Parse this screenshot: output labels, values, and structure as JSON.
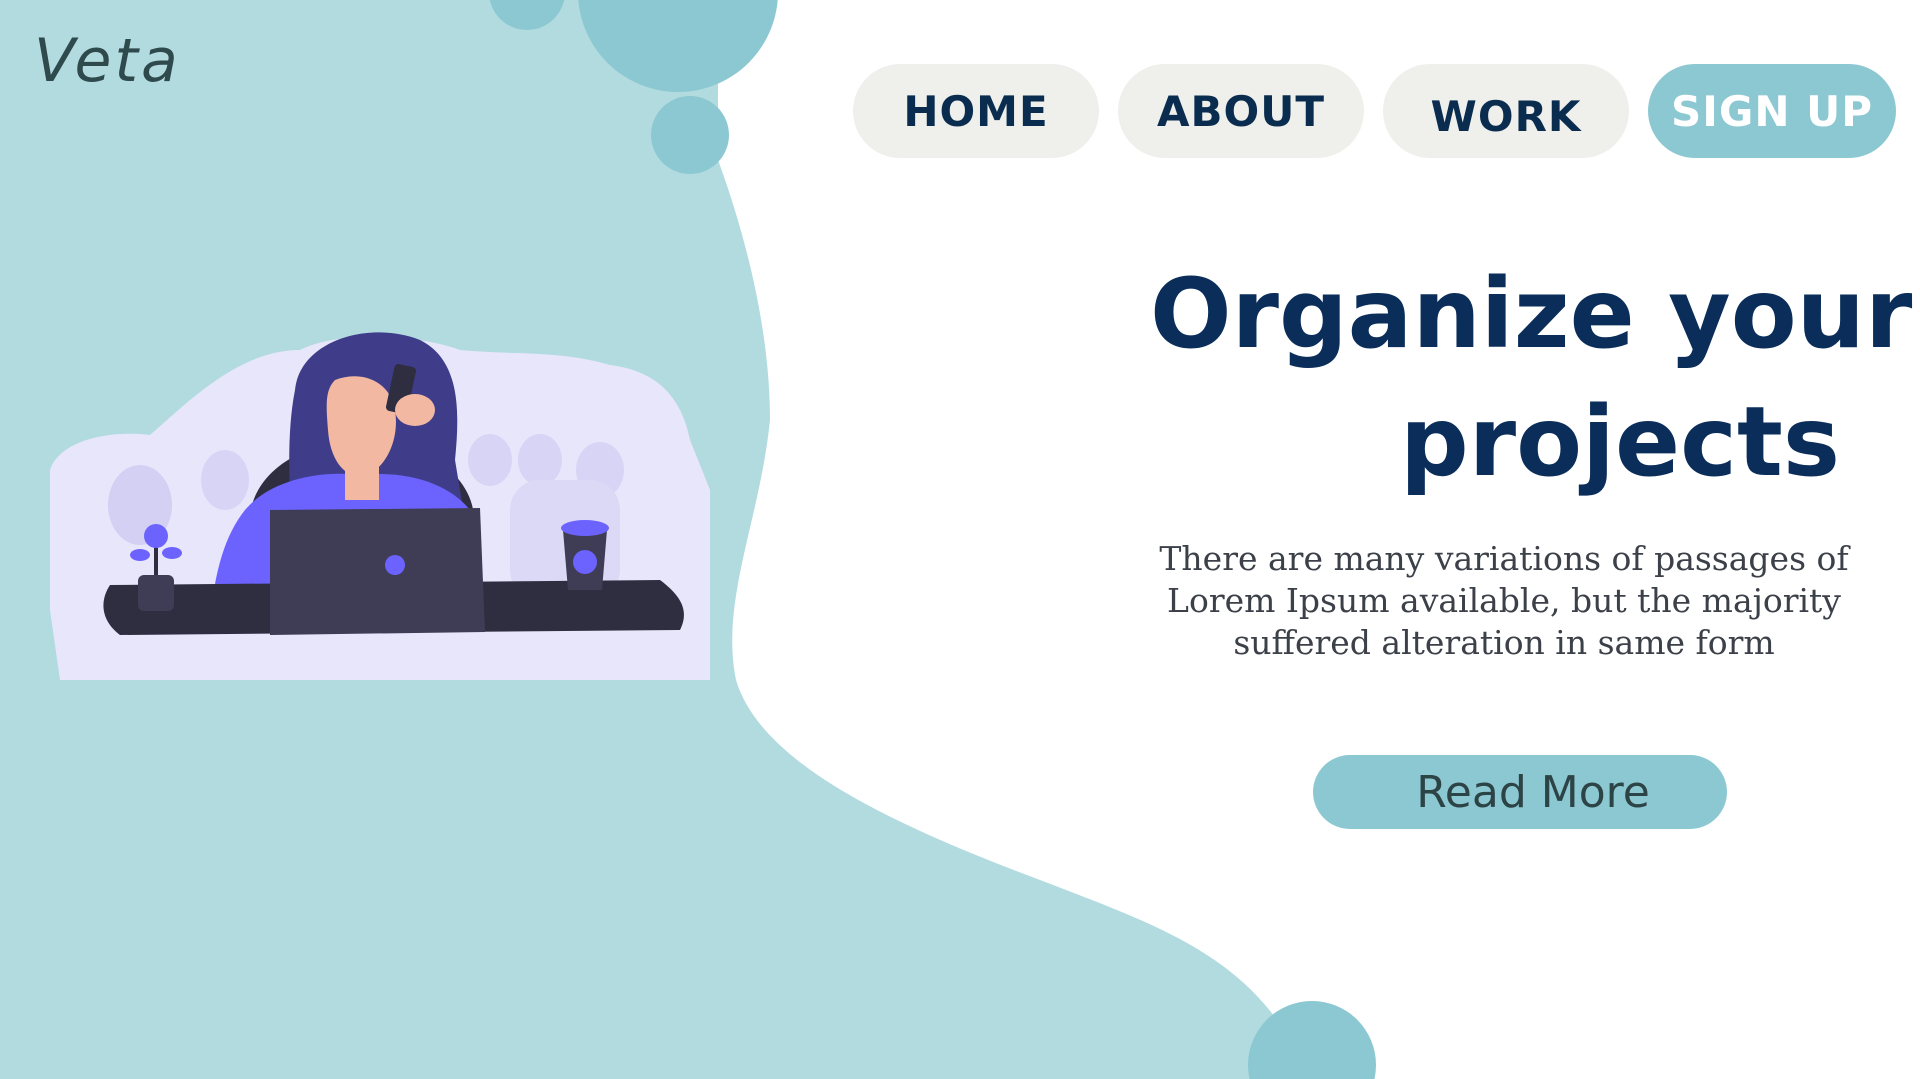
{
  "brand": {
    "logo_text": "Veta"
  },
  "nav": {
    "home": "HOME",
    "about": "ABOUT",
    "work": "WORK",
    "signup": "SIGN UP"
  },
  "hero": {
    "title_line1": "Organize your",
    "title_line2": "projects",
    "description": "There are many variations of passages of Lorem Ipsum available, but the majority suffered alteration in same form",
    "cta_label": "Read More"
  },
  "icons": {
    "illustration": "woman-at-laptop-illustration"
  },
  "colors": {
    "teal_light": "#b2dbe0",
    "teal_accent": "#8cc8d2",
    "nav_bg": "#efefec",
    "title_navy": "#0a2d5a",
    "purple": "#6c63ff",
    "desk_dark": "#2f2e41"
  }
}
